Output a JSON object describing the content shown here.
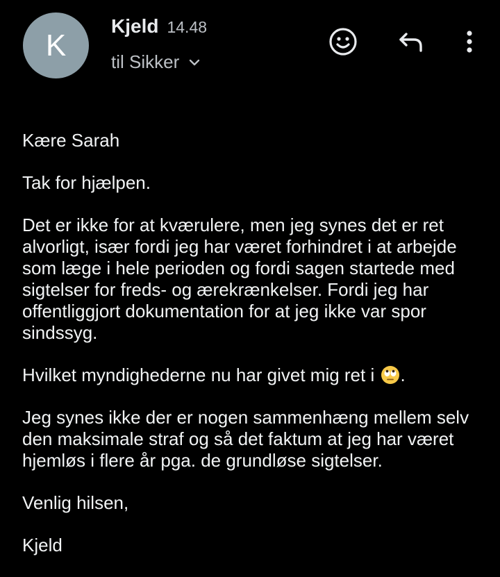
{
  "header": {
    "avatar_letter": "K",
    "sender_name": "Kjeld",
    "time": "14.48",
    "recipient": "til Sikker",
    "avatar_color": "#8d9fa8"
  },
  "icons": {
    "reaction": "smiley-face-icon",
    "reply": "reply-arrow-icon",
    "more": "more-vertical-icon",
    "expand": "chevron-down-icon",
    "inline_emoji": "face-with-rolling-eyes-emoji"
  },
  "message": {
    "greeting": "Kære Sarah",
    "p1": "Tak for hjælpen.",
    "p2": "Det er ikke for at kværulere, men jeg synes det er ret alvorligt, især fordi jeg har været forhindret i at arbejde som læge i hele perioden og fordi sagen startede med sigtelser for freds- og ærekrænkelser. Fordi jeg har offentliggjort dokumentation for at jeg ikke var spor sindssyg.",
    "p3_before": "Hvilket myndighederne nu har givet mig ret i ",
    "p3_after": ".",
    "p4": "Jeg synes ikke der er nogen sammenhæng mellem selv den maksimale straf og så det faktum at jeg har været hjemløs i flere år pga. de grundløse sigtelser.",
    "closing": "Venlig hilsen,",
    "signature": "Kjeld"
  }
}
